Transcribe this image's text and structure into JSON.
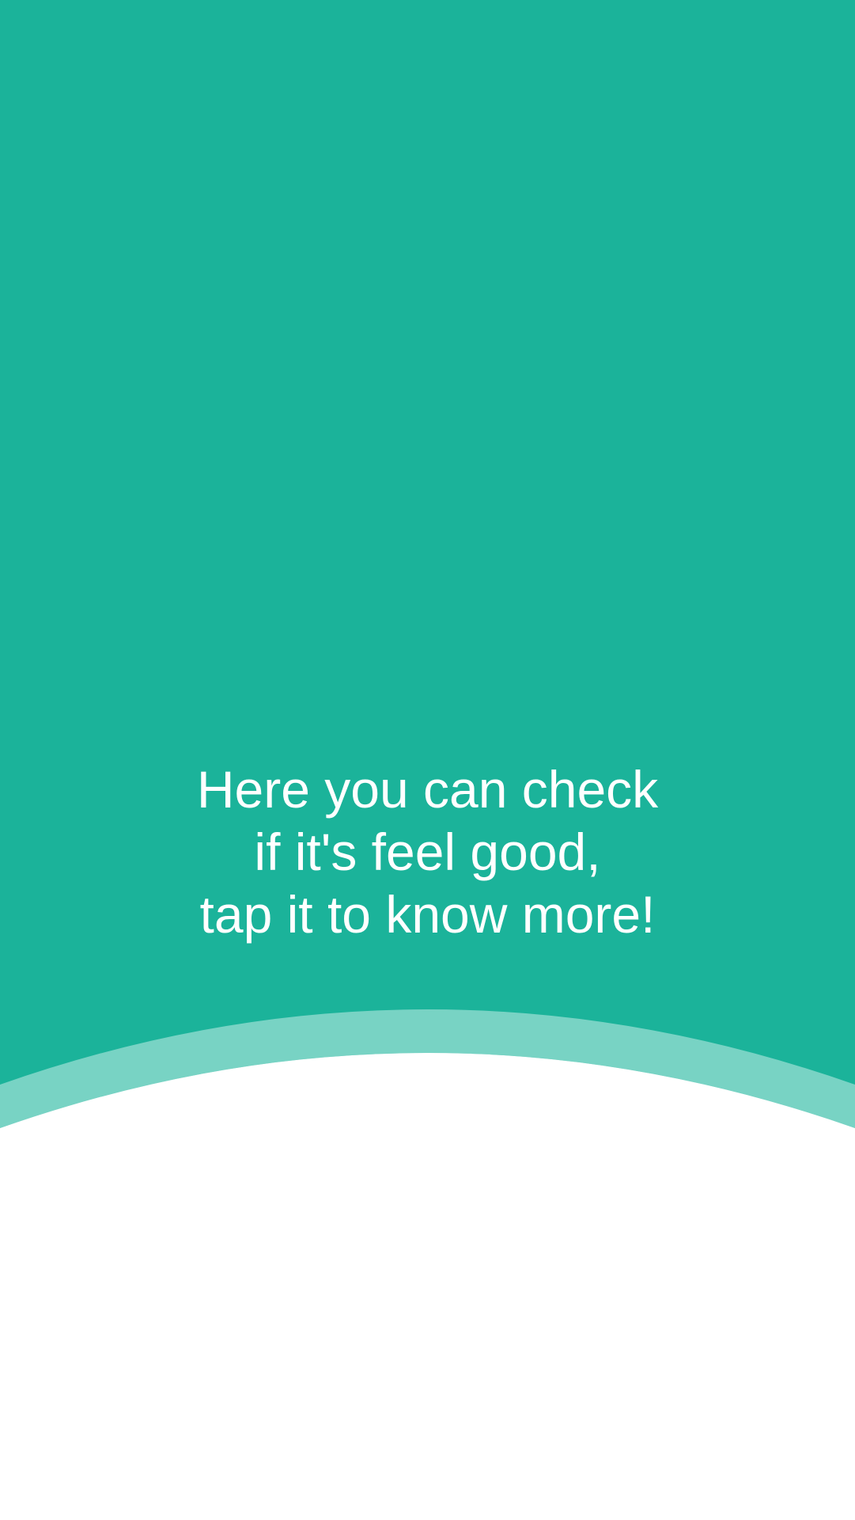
{
  "tooltip": {
    "lines": [
      "Here you can check",
      "if it's feel good,",
      "tap it to know more!"
    ]
  },
  "colors": {
    "primary": "#1BB39A",
    "accent_band": "#78D3C4",
    "background": "#FFFFFF",
    "text": "#FFFFFF"
  }
}
